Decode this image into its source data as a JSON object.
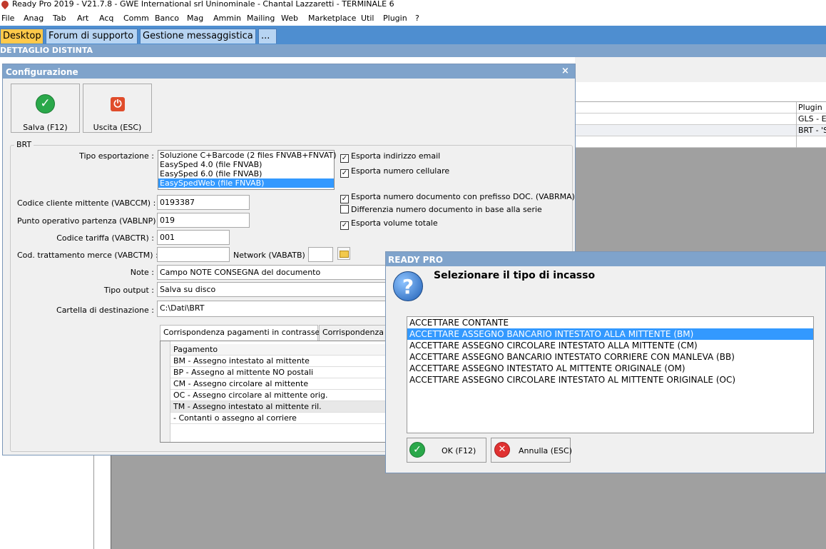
{
  "window": {
    "title": "Ready Pro 2019 - V21.7.8 - GWE International srl Uninominale - Chantal Lazzaretti - TERMINALE 6"
  },
  "menu": [
    "File",
    "Anag",
    "Tab",
    "Art",
    "Acq",
    "Comm",
    "Banco",
    "Mag",
    "Ammin",
    "Mailing",
    "Web",
    "Marketplace",
    "Util",
    "Plugin",
    "?"
  ],
  "tabs": [
    "Desktop",
    "Forum di supporto",
    "Gestione messaggistica",
    "..."
  ],
  "section_title": "DETTAGLIO DISTINTA",
  "plugin_panel": {
    "header": "Plugin",
    "rows": [
      "GLS - Es",
      "BRT - 'S",
      ""
    ]
  },
  "config": {
    "title": "Configurazione",
    "close": "×",
    "save_label": "Salva (F12)",
    "exit_label": "Uscita (ESC)",
    "group": "BRT",
    "export_label": "Tipo esportazione :",
    "export_options": [
      "Soluzione C+Barcode (2 files FNVAB+FNVAT)",
      "EasySped 4.0 (file FNVAB)",
      "EasySped 6.0 (file FNVAB)",
      "EasySpedWeb (file FNVAB)"
    ],
    "export_selected": 3,
    "fields": [
      {
        "label": "Codice cliente mittente (VABCCM) :",
        "value": "0193387"
      },
      {
        "label": "Punto operativo partenza (VABLNP) :",
        "value": "019"
      },
      {
        "label": "Codice tariffa (VABCTR) :",
        "value": "001"
      },
      {
        "label": "Cod. trattamento merce (VABCTM) :",
        "value": ""
      },
      {
        "label": "Note :",
        "value": "Campo NOTE CONSEGNA del documento"
      },
      {
        "label": "Tipo output :",
        "value": "Salva su disco"
      },
      {
        "label": "Cartella di destinazione :",
        "value": "C:\\Dati\\BRT"
      }
    ],
    "network_label": "Network (VABATB) :",
    "network_value": "",
    "checks": [
      {
        "label": "Esporta indirizzo email",
        "checked": true
      },
      {
        "label": "Esporta numero cellulare",
        "checked": true
      },
      {
        "label": "Esporta numero documento con prefisso DOC. (VABRMA)",
        "checked": true
      },
      {
        "label": "Differenzia numero documento in base alla serie",
        "checked": false
      },
      {
        "label": "Esporta volume totale",
        "checked": true
      }
    ],
    "subtabs": [
      "Corrispondenza pagamenti in contrassegno",
      "Corrispondenza na"
    ],
    "grid_header": "Pagamento",
    "grid_rows": [
      "BM - Assegno intestato al mittente",
      "BP - Assegno al mittente NO postali",
      "CM - Assegno circolare al mittente",
      "OC - Assegno circolare al mittente orig.",
      "TM - Assegno intestato al mittente ril.",
      "- Contanti o assegno al corriere"
    ]
  },
  "dialog": {
    "title": "READY PRO",
    "heading": "Selezionare il tipo di incasso",
    "options": [
      "ACCETTARE CONTANTE",
      "ACCETTARE ASSEGNO BANCARIO INTESTATO ALLA MITTENTE (BM)",
      "ACCETTARE ASSEGNO CIRCOLARE INTESTATO ALLA MITTENTE (CM)",
      "ACCETTARE ASSEGNO BANCARIO INTESTATO CORRIERE CON MANLEVA (BB)",
      "ACCETTARE ASSEGNO INTESTATO AL MITTENTE ORIGINALE (OM)",
      "ACCETTARE ASSEGNO CIRCOLARE INTESTATO AL MITTENTE ORIGINALE (OC)"
    ],
    "selected": 1,
    "ok_label": "OK (F12)",
    "cancel_label": "Annulla (ESC)"
  },
  "colors": {
    "accent_blue": "#7fa3cb",
    "tab_blue": "#4e8ed0",
    "active_tab": "#ffc94a",
    "selection": "#3399ff"
  }
}
